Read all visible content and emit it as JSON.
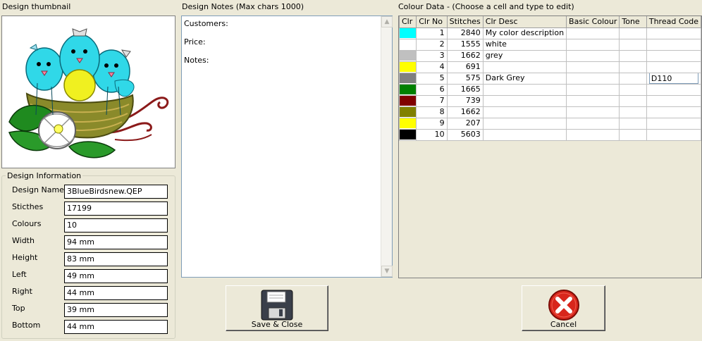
{
  "thumbnail": {
    "caption": "Design thumbnail"
  },
  "design_info": {
    "legend": "Design Information",
    "fields": [
      {
        "label": "Design Name",
        "value": "3BlueBirdsnew.QEP"
      },
      {
        "label": "Sticthes",
        "value": "17199"
      },
      {
        "label": "Colours",
        "value": "10"
      },
      {
        "label": "Width",
        "value": "94 mm"
      },
      {
        "label": "Height",
        "value": "83 mm"
      },
      {
        "label": "Left",
        "value": "49 mm"
      },
      {
        "label": "Right",
        "value": "44 mm"
      },
      {
        "label": "Top",
        "value": "39 mm"
      },
      {
        "label": "Bottom",
        "value": "44 mm"
      }
    ]
  },
  "notes": {
    "caption": "Design Notes (Max chars 1000)",
    "text": "Customers:\n\nPrice:\n\nNotes:"
  },
  "colour_data": {
    "caption": "Colour Data - (Choose a cell and type to edit)",
    "columns": [
      "Clr",
      "Clr No",
      "Stitches",
      "Clr Desc",
      "Basic Colour",
      "Tone",
      "Thread Code"
    ],
    "rows": [
      {
        "color": "#00ffff",
        "no": "1",
        "stitches": "2840",
        "desc": "My color description",
        "basic": "",
        "tone": "",
        "code": ""
      },
      {
        "color": "#ffffff",
        "no": "2",
        "stitches": "1555",
        "desc": "white",
        "basic": "",
        "tone": "",
        "code": ""
      },
      {
        "color": "#c0c0c0",
        "no": "3",
        "stitches": "1662",
        "desc": "grey",
        "basic": "",
        "tone": "",
        "code": ""
      },
      {
        "color": "#ffff00",
        "no": "4",
        "stitches": "691",
        "desc": "",
        "basic": "",
        "tone": "",
        "code": ""
      },
      {
        "color": "#808080",
        "no": "5",
        "stitches": "575",
        "desc": "Dark Grey",
        "basic": "",
        "tone": "",
        "code": "D110"
      },
      {
        "color": "#008000",
        "no": "6",
        "stitches": "1665",
        "desc": "",
        "basic": "",
        "tone": "",
        "code": ""
      },
      {
        "color": "#800000",
        "no": "7",
        "stitches": "739",
        "desc": "",
        "basic": "",
        "tone": "",
        "code": ""
      },
      {
        "color": "#808000",
        "no": "8",
        "stitches": "1662",
        "desc": "",
        "basic": "",
        "tone": "",
        "code": ""
      },
      {
        "color": "#ffff00",
        "no": "9",
        "stitches": "207",
        "desc": "",
        "basic": "",
        "tone": "",
        "code": ""
      },
      {
        "color": "#000000",
        "no": "10",
        "stitches": "5603",
        "desc": "",
        "basic": "",
        "tone": "",
        "code": ""
      }
    ],
    "editing_row": 4
  },
  "buttons": {
    "save_label": "Save & Close",
    "cancel_label": "Cancel",
    "save_icon": "floppy-disk-icon",
    "cancel_icon": "red-x-icon"
  }
}
